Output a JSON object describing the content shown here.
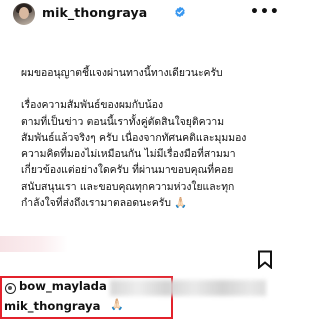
{
  "header": {
    "username": "mik_thongraya",
    "verified_icon": "verified-badge-icon",
    "more_icon": "more-options-icon",
    "more_label": "•••"
  },
  "caption": {
    "lines": [
      "ผมขออนุญาตชี้แจงผ่านทางนี้ทางเดียวนะครับ",
      "",
      "เรื่องความสัมพันธ์ของผมกับน้อง",
      "ตามที่เป็นข่าว ตอนนี้เราทั้งคู่ตัดสินใจยุติความ",
      "สัมพันธ์แล้วจริงๆ ครับ เนื่องจากทัศนคติและมุมมอง",
      "ความคิดที่มองไม่เหมือนกัน ไม่มีเรื่องมือที่สามมา",
      "เกี่ยวข้องแต่อย่างใดครับ ที่ผ่านมาขอบคุณที่คอย",
      "สนับสนุนเรา และขอบคุณทุกความห่วงใยและทุก",
      "กำลังใจที่ส่งถึงเรามาตลอดนะครับ 🙏🏻"
    ]
  },
  "actions": {
    "bookmark_icon": "bookmark-icon"
  },
  "comments": [
    {
      "username": "bow_maylada",
      "text_hidden": true
    },
    {
      "username": "mik_thongraya",
      "text": "🙏🏻"
    }
  ],
  "colors": {
    "highlight_border": "#e3212b",
    "verified_blue": "#3897f0"
  }
}
